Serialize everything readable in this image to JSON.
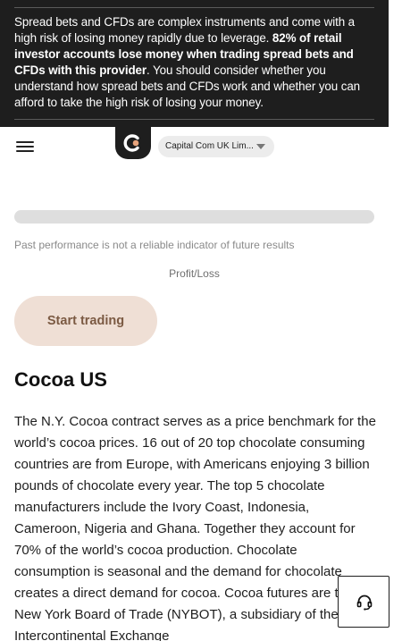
{
  "risk_warning": {
    "part1": "Spread bets and CFDs are complex instruments and come with a high risk of losing money rapidly due to leverage. ",
    "part2_bold": "82% of retail investor accounts lose money when trading spread bets and CFDs with this provider",
    "part3": ". You should consider whether you understand how spread bets and CFDs work and whether you can afford to take the high risk of losing your money."
  },
  "header": {
    "menu_icon": "hamburger-menu-icon",
    "logo_icon": "capital-com-logo",
    "entity_selector": "Capital Com UK Lim..."
  },
  "calculator": {
    "disclaimer": "Past performance is not a reliable indicator of future results",
    "profit_loss_label": "Profit/Loss"
  },
  "cta": {
    "start_trading": "Start trading"
  },
  "asset": {
    "title": "Cocoa US",
    "description": "The N.Y. Cocoa contract serves as a price benchmark for the world’s cocoa prices. 16 out of 20 top chocolate consuming countries are from Europe, with Americans enjoying 3 billion pounds of chocolate every year. The top 5 chocolate manufacturers include the Ivory Coast, Indonesia, Cameroon, Nigeria and Ghana. Together they account for 70% of the world’s cocoa production. Chocolate consumption is seasonal and the demand for chocolate creates a direct demand for cocoa. Cocoa futures are traded New York Board of Trade (NYBOT), a subsidiary of the Intercontinental Exchange"
  },
  "support": {
    "icon": "headset-support-icon"
  },
  "colors": {
    "banner_bg": "#1e1e1e",
    "cta_bg": "#efdfd5",
    "cta_text": "#7b5a43",
    "logo_accent": "#e8a47c"
  }
}
